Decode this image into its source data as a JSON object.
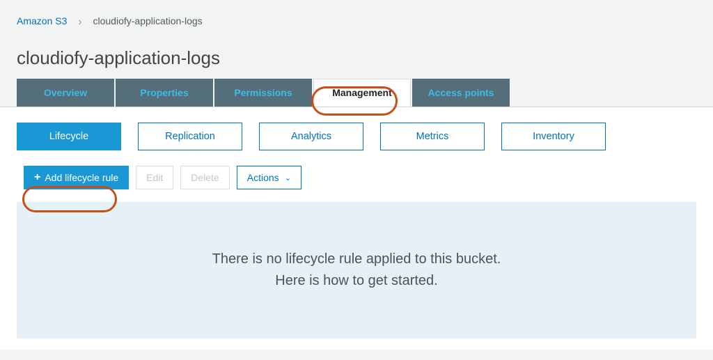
{
  "breadcrumb": {
    "root": "Amazon S3",
    "current": "cloudiofy-application-logs"
  },
  "page_title": "cloudiofy-application-logs",
  "tabs": {
    "overview": "Overview",
    "properties": "Properties",
    "permissions": "Permissions",
    "management": "Management",
    "access_points": "Access points"
  },
  "sub_tabs": {
    "lifecycle": "Lifecycle",
    "replication": "Replication",
    "analytics": "Analytics",
    "metrics": "Metrics",
    "inventory": "Inventory"
  },
  "toolbar": {
    "add_rule": "Add lifecycle rule",
    "edit": "Edit",
    "delete": "Delete",
    "actions": "Actions"
  },
  "empty_state": {
    "line1": "There is no lifecycle rule applied to this bucket.",
    "line2": "Here is how to get started."
  }
}
